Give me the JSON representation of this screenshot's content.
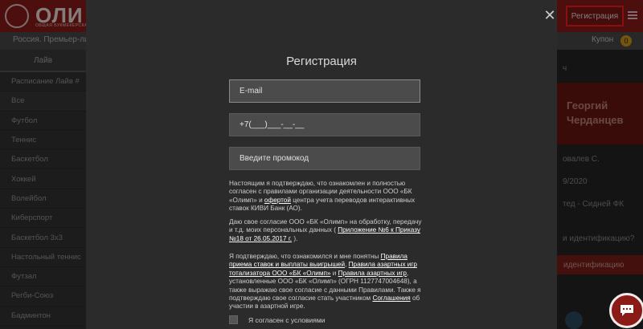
{
  "app": {
    "logo_text": "ОЛИ",
    "logo_sub": "ОБЩАЯ БУКМЕКЕРСКАЯ",
    "register_label": "Регистрация",
    "breadcrumb": "Россия. Премьер-лиг",
    "coupon_label": "Купон",
    "coupon_count": "0"
  },
  "sidebar": {
    "live_tab": "Лайв",
    "items": [
      "Расписание Лайв #",
      "Все",
      "Футбол",
      "Теннис",
      "Баскетбол",
      "Хоккей",
      "Волейбол",
      "Киберспорт",
      "Баскетбол 3х3",
      "Настольный теннис",
      "Футзал",
      "Регби-Союз",
      "Бадминтон"
    ]
  },
  "right_panel": {
    "promo_name": "Георгий\nЧерданцев",
    "text_1": "ч",
    "text_2": "овалев С.",
    "text_3": "9/2020",
    "text_4": "тед - Сидней ФК",
    "text_5": "и идентификацию?",
    "button": "идентификацию"
  },
  "modal": {
    "title": "Регистрация",
    "email_placeholder": "E-mail",
    "phone_value": "+7(___)___-__-__",
    "promo_placeholder": "Введите промокод",
    "consent_1": {
      "before": "Настоящим я подтверждаю, что ознакомлен и полностью согласен с правилами организации деятельности ООО «БК «Олимп» и ",
      "link": "офертой",
      "after": " центра учета переводов интерактивных ставок КИВИ Банк (АО)."
    },
    "consent_2": {
      "before": "Даю свое согласие ООО «БК «Олимп» на обработку, передачу и т.д. моих персональных данных ( ",
      "link": "Приложение №6 к Приказу №18 от 26.05.2017 г.",
      "after": " )."
    },
    "consent_3": {
      "p1": "Я подтверждаю, что ознакомился и мне понятны ",
      "l1": "Правила приема ставок и выплаты выигрышей",
      "p2": ", ",
      "l2": "Правила азартных игр тотализатора ООО «БК «Олимп»",
      "p3": " и ",
      "l3": "Правила азартных игр",
      "p4": ", установленные ООО «БК «Олимп» (ОГРН 1127747004648), а также выражаю свое согласие с данными Правилами. Также я подтверждаю свое согласие стать участником ",
      "l4": "Соглашения",
      "p5": " об участии в азартной игре."
    },
    "agree_label": "Я согласен с условиями"
  },
  "colors": {
    "brand": "#8a1c18",
    "highlight": "#ff1a1a",
    "modal_bg": "#2b2b2b",
    "field_bg": "#4b4b4b"
  }
}
